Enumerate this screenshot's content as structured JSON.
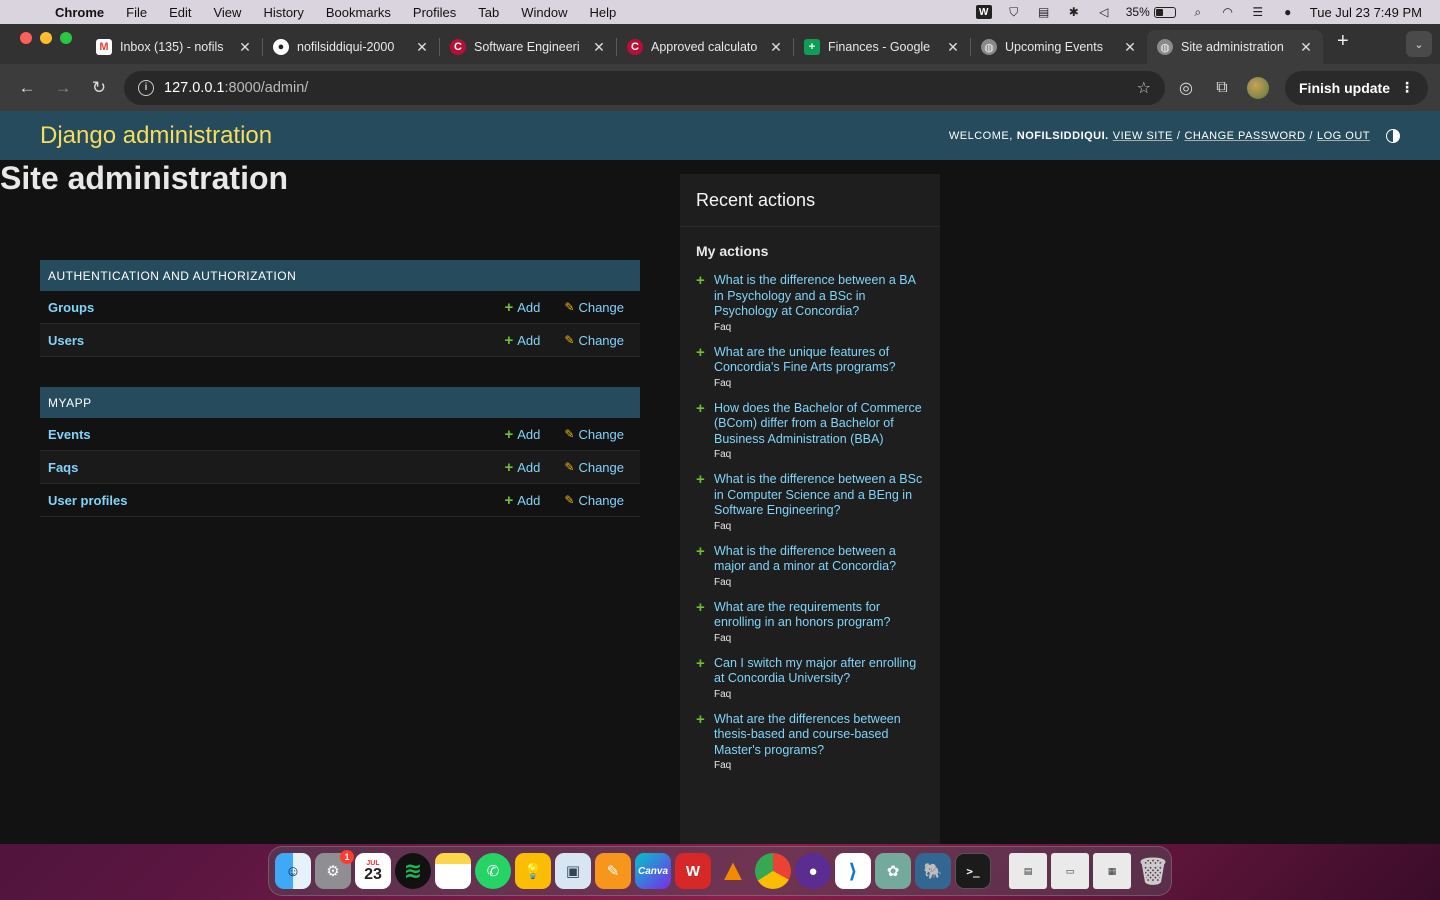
{
  "menubar": {
    "app_name": "Chrome",
    "items": [
      "File",
      "Edit",
      "View",
      "History",
      "Bookmarks",
      "Profiles",
      "Tab",
      "Window",
      "Help"
    ],
    "battery": "35%",
    "datetime": "Tue Jul 23  7:49 PM"
  },
  "tabs": [
    {
      "title": "Inbox (135) - nofils",
      "icon": "gmail-icon"
    },
    {
      "title": "nofilsiddiqui-2000",
      "icon": "github-icon"
    },
    {
      "title": "Software Engineeri",
      "icon": "concordia-icon"
    },
    {
      "title": "Approved calculato",
      "icon": "concordia-icon"
    },
    {
      "title": "Finances - Google",
      "icon": "sheets-icon"
    },
    {
      "title": "Upcoming Events",
      "icon": "globe-icon"
    },
    {
      "title": "Site administration",
      "icon": "globe-icon",
      "active": true
    }
  ],
  "toolbar": {
    "url_host": "127.0.0.1",
    "url_path": ":8000/admin/",
    "finish_update": "Finish update"
  },
  "admin": {
    "branding": "Django administration",
    "welcome": "WELCOME,",
    "username": "NOFILSIDDIQUI.",
    "view_site": "VIEW SITE",
    "change_password": "CHANGE PASSWORD",
    "log_out": "LOG OUT",
    "page_title": "Site administration",
    "add_label": "Add",
    "change_label": "Change",
    "modules": [
      {
        "caption": "AUTHENTICATION AND AUTHORIZATION",
        "models": [
          "Groups",
          "Users"
        ]
      },
      {
        "caption": "MYAPP",
        "models": [
          "Events",
          "Faqs",
          "User profiles"
        ]
      }
    ],
    "recent_actions_title": "Recent actions",
    "my_actions_title": "My actions",
    "actions": [
      {
        "text": "What is the difference between a BA in Psychology and a BSc in Psychology at Concordia?",
        "type": "Faq"
      },
      {
        "text": "What are the unique features of Concordia's Fine Arts programs?",
        "type": "Faq"
      },
      {
        "text": "How does the Bachelor of Commerce (BCom) differ from a Bachelor of Business Administration (BBA)",
        "type": "Faq"
      },
      {
        "text": "What is the difference between a BSc in Computer Science and a BEng in Software Engineering?",
        "type": "Faq"
      },
      {
        "text": "What is the difference between a major and a minor at Concordia?",
        "type": "Faq"
      },
      {
        "text": "What are the requirements for enrolling in an honors program?",
        "type": "Faq"
      },
      {
        "text": "Can I switch my major after enrolling at Concordia University?",
        "type": "Faq"
      },
      {
        "text": "What are the differences between thesis-based and course-based Master's programs?",
        "type": "Faq"
      }
    ]
  },
  "dock": {
    "calendar_month": "JUL",
    "calendar_day": "23",
    "settings_badge": "1",
    "apps": [
      "finder-icon",
      "system-settings-icon",
      "calendar-icon",
      "spotify-icon",
      "notes-icon",
      "whatsapp-icon",
      "keep-icon",
      "preview-icon",
      "pages-icon",
      "canva-icon",
      "wps-icon",
      "vlc-icon",
      "chrome-icon",
      "github-desktop-icon",
      "vscode-icon",
      "chatgpt-icon",
      "pgadmin-icon",
      "terminal-icon",
      "trash-icon"
    ],
    "canva_label": "Canva"
  },
  "colors": {
    "header_bg": "#264b5d",
    "branding": "#f5dd5d",
    "link": "#81d4fa",
    "add_green": "#70bf2b",
    "change_yellow": "#efb80b",
    "page_bg": "#121212"
  }
}
